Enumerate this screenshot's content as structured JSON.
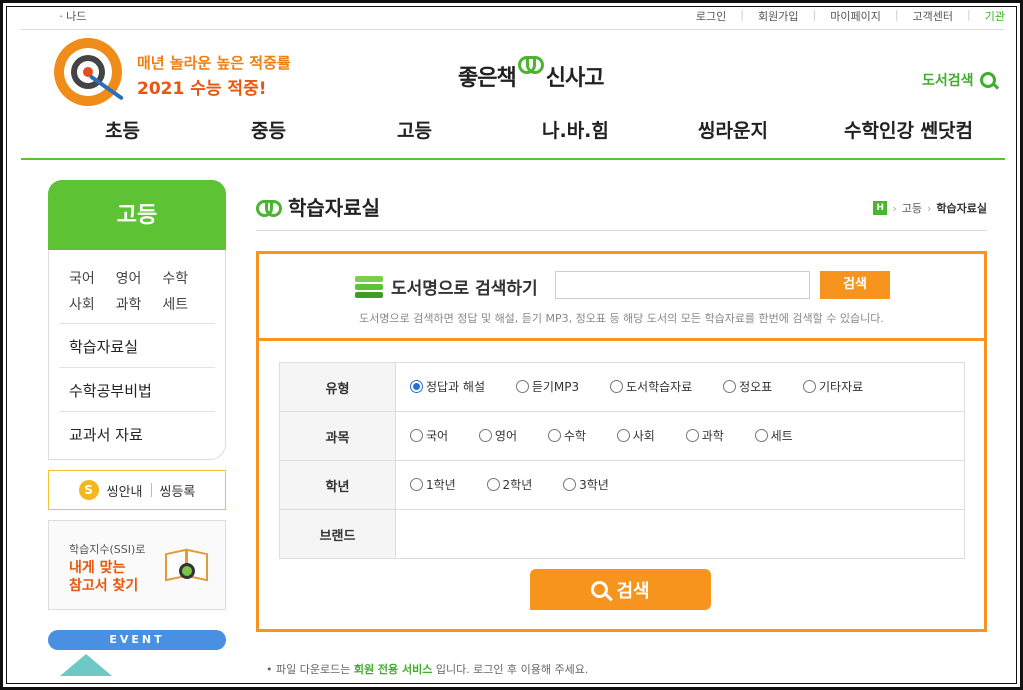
{
  "util": {
    "left": "ㆍ나드",
    "right": [
      "로그인",
      "회원가입",
      "마이페이지",
      "고객센터",
      "기관"
    ]
  },
  "promo": {
    "line1": "매년 놀라운 높은 적중률",
    "line2": "2021 수능 적중!"
  },
  "logo": {
    "part1": "좋은책",
    "part2": "신사고"
  },
  "header": {
    "book_search": "도서검색"
  },
  "gnb": [
    "초등",
    "중등",
    "고등",
    "나.바.힘",
    "씽라운지",
    "수학인강 쎈닷컴"
  ],
  "sidebar": {
    "title": "고등",
    "subjects": [
      "국어",
      "영어",
      "수학",
      "사회",
      "과학",
      "세트"
    ],
    "links": [
      "학습자료실",
      "수학공부비법",
      "교과서 자료"
    ],
    "point": {
      "coin": "S",
      "a": "씽안내",
      "b": "씽등록"
    },
    "ssi": {
      "t1": "학습지수(SSI)로",
      "t2": "내게 맞는",
      "t3": "참고서 찾기"
    },
    "event": "EVENT"
  },
  "main": {
    "title": "학습자료실",
    "breadcrumb": {
      "home": "H",
      "a": "고등",
      "b": "학습자료실"
    },
    "search": {
      "label": "도서명으로 검색하기",
      "input_value": "",
      "button": "검색",
      "hint": "도서명으로 검색하면 정답 및 해설, 듣기 MP3, 정오표 등 해당 도서의 모든 학습자료를 한번에 검색할 수 있습니다."
    },
    "filters": [
      {
        "label": "유형",
        "options": [
          "정답과 해설",
          "듣기MP3",
          "도서학습자료",
          "정오표",
          "기타자료"
        ],
        "selected": 0
      },
      {
        "label": "과목",
        "options": [
          "국어",
          "영어",
          "수학",
          "사회",
          "과학",
          "세트"
        ],
        "selected": -1
      },
      {
        "label": "학년",
        "options": [
          "1학년",
          "2학년",
          "3학년"
        ],
        "selected": -1
      },
      {
        "label": "브랜드",
        "options": [],
        "selected": -1
      }
    ],
    "big_search": "검색",
    "notice": {
      "pre": "• 파일 다운로드는 ",
      "hl": "회원 전용 서비스",
      "post": " 입니다. 로그인 후 이용해 주세요."
    }
  }
}
